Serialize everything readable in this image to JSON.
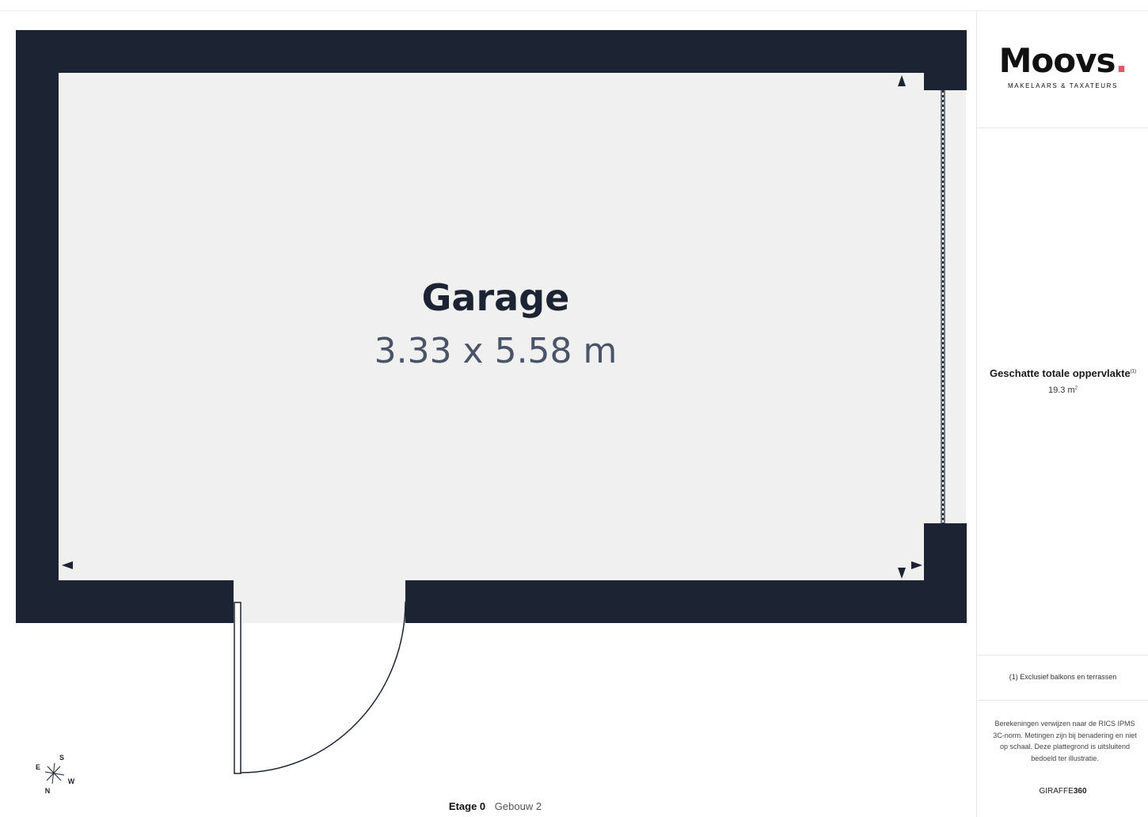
{
  "plan": {
    "room_name": "Garage",
    "room_dimensions": "3.33 x 5.58 m"
  },
  "compass": {
    "north": "N",
    "east": "E",
    "south": "S",
    "west": "W"
  },
  "floor": {
    "level": "Etage 0",
    "building": "Gebouw 2"
  },
  "sidebar": {
    "logo_word": "Moovs",
    "logo_dot": ".",
    "logo_subtitle": "MAKELAARS & TAXATEURS",
    "area_label": "Geschatte totale oppervlakte",
    "area_footnote_mark": "(1)",
    "area_value": "19.3 m",
    "area_unit_sup": "2",
    "footnote": "(1) Exclusief balkons en terrassen",
    "disclaimer": "Berekeningen verwijzen naar de RICS IPMS 3C-norm. Metingen zijn bij benadering en niet op schaal. Deze plattegrond is uitsluitend bedoeld ter illustratie.",
    "brand_prefix": "GIRAFFE",
    "brand_suffix": "360"
  },
  "colors": {
    "wall": "#1c2433",
    "floor": "#f0f0f0",
    "room_name": "#1c2433",
    "dimensions": "#4a5468",
    "logo_dot": "#e8526a"
  }
}
